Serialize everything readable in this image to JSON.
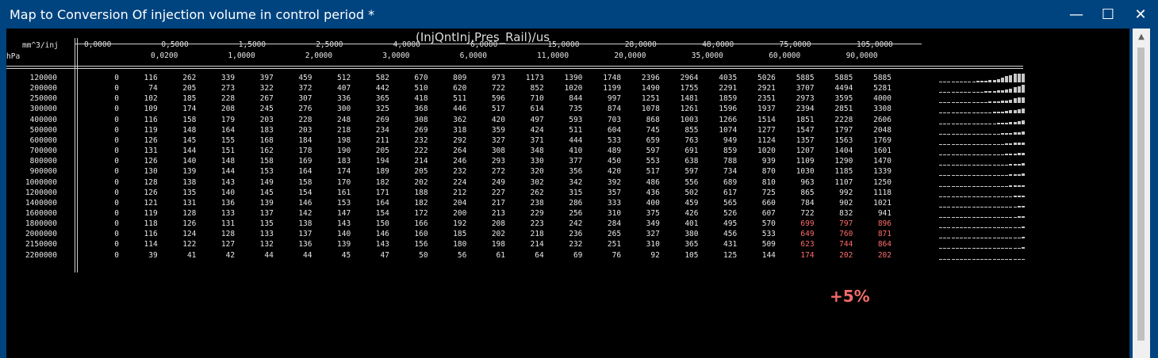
{
  "window": {
    "title": "Map to Conversion Of injection volume in control period *",
    "minimize": "—",
    "maximize": "☐",
    "close": "✕"
  },
  "map": {
    "title": "(InjQntInj,Pres_Rail)/us",
    "x_unit": "mm^3/inj",
    "y_unit": "hPa",
    "annotation": "+5%",
    "x_axis_top": [
      "0,0000",
      "0,5000",
      "1,5000",
      "2,5000",
      "4,0000",
      "6,0000",
      "15,0000",
      "28,0000",
      "48,0000",
      "75,0000",
      "105,0000"
    ],
    "x_axis_bottom": [
      "0,0200",
      "1,0000",
      "2,0000",
      "3,0000",
      "6,0000",
      "11,0000",
      "20,0000",
      "35,0000",
      "60,0000",
      "90,0000"
    ],
    "rows": [
      {
        "p": "120000",
        "v": [
          "0",
          "116",
          "262",
          "339",
          "397",
          "459",
          "512",
          "582",
          "670",
          "809",
          "973",
          "1173",
          "1390",
          "1748",
          "2396",
          "2964",
          "4035",
          "5026",
          "5885",
          "5885",
          "5885"
        ]
      },
      {
        "p": "200000",
        "v": [
          "0",
          "74",
          "205",
          "273",
          "322",
          "372",
          "407",
          "442",
          "510",
          "620",
          "722",
          "852",
          "1020",
          "1199",
          "1490",
          "1755",
          "2291",
          "2921",
          "3707",
          "4494",
          "5281"
        ]
      },
      {
        "p": "250000",
        "v": [
          "0",
          "102",
          "185",
          "228",
          "267",
          "307",
          "336",
          "365",
          "418",
          "511",
          "596",
          "710",
          "844",
          "997",
          "1251",
          "1481",
          "1859",
          "2351",
          "2973",
          "3595",
          "4000"
        ]
      },
      {
        "p": "300000",
        "v": [
          "0",
          "109",
          "174",
          "208",
          "245",
          "276",
          "300",
          "325",
          "368",
          "446",
          "517",
          "614",
          "735",
          "874",
          "1078",
          "1261",
          "1596",
          "1937",
          "2394",
          "2851",
          "3308"
        ]
      },
      {
        "p": "400000",
        "v": [
          "0",
          "116",
          "158",
          "179",
          "203",
          "228",
          "248",
          "269",
          "308",
          "362",
          "420",
          "497",
          "593",
          "703",
          "868",
          "1003",
          "1266",
          "1514",
          "1851",
          "2228",
          "2606"
        ]
      },
      {
        "p": "500000",
        "v": [
          "0",
          "119",
          "148",
          "164",
          "183",
          "203",
          "218",
          "234",
          "269",
          "318",
          "359",
          "424",
          "511",
          "604",
          "745",
          "855",
          "1074",
          "1277",
          "1547",
          "1797",
          "2048"
        ]
      },
      {
        "p": "600000",
        "v": [
          "0",
          "126",
          "145",
          "155",
          "168",
          "184",
          "198",
          "211",
          "232",
          "292",
          "327",
          "371",
          "444",
          "533",
          "659",
          "763",
          "949",
          "1124",
          "1357",
          "1563",
          "1769"
        ]
      },
      {
        "p": "700000",
        "v": [
          "0",
          "131",
          "144",
          "151",
          "162",
          "178",
          "190",
          "205",
          "222",
          "264",
          "308",
          "348",
          "410",
          "489",
          "597",
          "691",
          "859",
          "1020",
          "1207",
          "1404",
          "1601"
        ]
      },
      {
        "p": "800000",
        "v": [
          "0",
          "126",
          "140",
          "148",
          "158",
          "169",
          "183",
          "194",
          "214",
          "246",
          "293",
          "330",
          "377",
          "450",
          "553",
          "638",
          "788",
          "939",
          "1109",
          "1290",
          "1470"
        ]
      },
      {
        "p": "900000",
        "v": [
          "0",
          "130",
          "139",
          "144",
          "153",
          "164",
          "174",
          "189",
          "205",
          "232",
          "272",
          "320",
          "356",
          "420",
          "517",
          "597",
          "734",
          "870",
          "1030",
          "1185",
          "1339"
        ]
      },
      {
        "p": "1000000",
        "v": [
          "0",
          "128",
          "138",
          "143",
          "149",
          "158",
          "170",
          "182",
          "202",
          "224",
          "249",
          "302",
          "342",
          "392",
          "486",
          "556",
          "689",
          "810",
          "963",
          "1107",
          "1250"
        ]
      },
      {
        "p": "1200000",
        "v": [
          "0",
          "126",
          "135",
          "140",
          "145",
          "154",
          "161",
          "171",
          "188",
          "212",
          "227",
          "262",
          "315",
          "357",
          "436",
          "502",
          "617",
          "725",
          "865",
          "992",
          "1118"
        ]
      },
      {
        "p": "1400000",
        "v": [
          "0",
          "121",
          "131",
          "136",
          "139",
          "146",
          "153",
          "164",
          "182",
          "204",
          "217",
          "238",
          "286",
          "333",
          "400",
          "459",
          "565",
          "660",
          "784",
          "902",
          "1021"
        ]
      },
      {
        "p": "1600000",
        "v": [
          "0",
          "119",
          "128",
          "133",
          "137",
          "142",
          "147",
          "154",
          "172",
          "200",
          "213",
          "229",
          "256",
          "310",
          "375",
          "426",
          "526",
          "607",
          "722",
          "832",
          "941"
        ]
      },
      {
        "p": "1800000",
        "v": [
          "0",
          "118",
          "126",
          "131",
          "135",
          "138",
          "143",
          "150",
          "166",
          "192",
          "208",
          "223",
          "242",
          "284",
          "349",
          "401",
          "495",
          "570",
          "699",
          "797",
          "896"
        ]
      },
      {
        "p": "2000000",
        "v": [
          "0",
          "116",
          "124",
          "128",
          "133",
          "137",
          "140",
          "146",
          "160",
          "185",
          "202",
          "218",
          "236",
          "265",
          "327",
          "380",
          "456",
          "533",
          "649",
          "760",
          "871"
        ]
      },
      {
        "p": "2150000",
        "v": [
          "0",
          "114",
          "122",
          "127",
          "132",
          "136",
          "139",
          "143",
          "156",
          "180",
          "198",
          "214",
          "232",
          "251",
          "310",
          "365",
          "431",
          "509",
          "623",
          "744",
          "864"
        ]
      },
      {
        "p": "2200000",
        "v": [
          "0",
          "39",
          "41",
          "42",
          "44",
          "44",
          "45",
          "47",
          "50",
          "56",
          "61",
          "64",
          "69",
          "76",
          "92",
          "105",
          "125",
          "144",
          "174",
          "202",
          "202"
        ]
      }
    ],
    "red_rows": [
      "1800000",
      "2000000",
      "2150000",
      "2200000"
    ],
    "red_from_col": 18,
    "colors": {
      "text": "#e6e6e6",
      "highlight": "#ff6b6b",
      "annotation": "#f26a6a",
      "titlebar": "#00447f"
    }
  }
}
